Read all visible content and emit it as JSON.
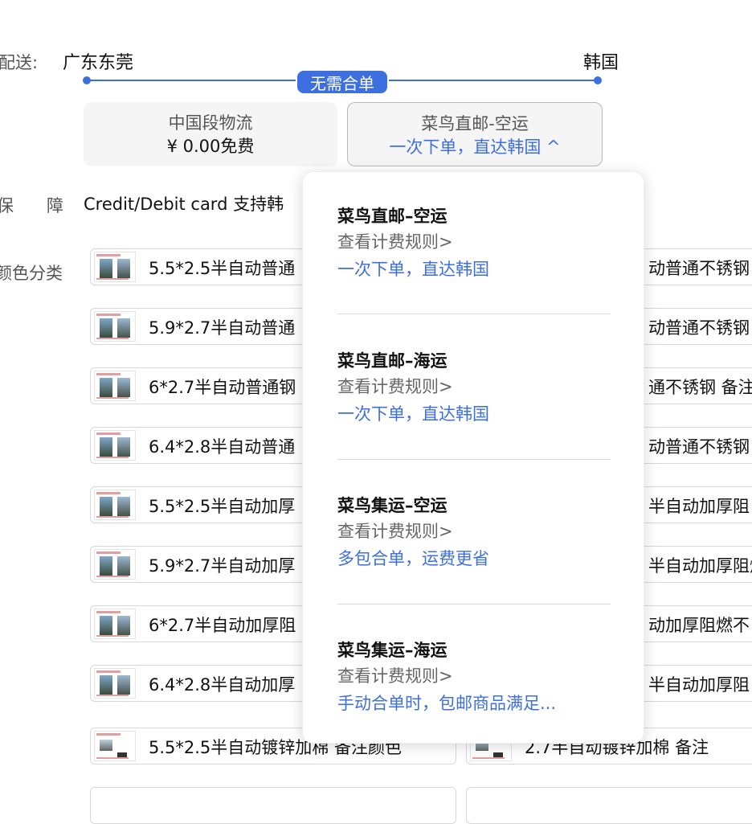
{
  "shipping": {
    "label_partial": "配送:",
    "origin": "广东东莞",
    "destination": "韩国",
    "route_badge": "无需合单",
    "options": [
      {
        "title": "中国段物流",
        "subtitle": "¥ 0.00免费"
      },
      {
        "title": "菜鸟直邮-空运",
        "subtitle": "一次下单，直达韩国 ^"
      }
    ]
  },
  "guarantee": {
    "label_a": "保",
    "label_b": "障",
    "text": "Credit/Debit card 支持韩"
  },
  "variants": {
    "label": "颜色分类",
    "left_items": [
      "5.5*2.5半自动普通",
      "5.9*2.7半自动普通",
      "6*2.7半自动普通钢",
      "6.4*2.8半自动普通",
      "5.5*2.5半自动加厚",
      "5.9*2.7半自动加厚",
      "6*2.7半自动加厚阻",
      "6.4*2.8半自动加厚",
      "5.5*2.5半自动镀锌加棉 备注颜色"
    ],
    "right_items": [
      "动普通不锈钢",
      "动普通不锈钢",
      "通不锈钢 备注",
      "动普通不锈钢",
      "半自动加厚阻",
      "半自动加厚阻燃",
      "动加厚阻燃不",
      "半自动加厚阻",
      "2.7半自动镀锌加棉 备注"
    ]
  },
  "dropdown": {
    "items": [
      {
        "title": "菜鸟直邮–空运",
        "rule": "查看计费规则>",
        "desc": "一次下单，直达韩国"
      },
      {
        "title": "菜鸟直邮–海运",
        "rule": "查看计费规则>",
        "desc": "一次下单，直达韩国"
      },
      {
        "title": "菜鸟集运–空运",
        "rule": "查看计费规则>",
        "desc": "多包合单，运费更省"
      },
      {
        "title": "菜鸟集运–海运",
        "rule": "查看计费规则>",
        "desc": "手动合单时，包邮商品满足..."
      }
    ]
  },
  "colors": {
    "accent": "#3d6fe0",
    "card_bg": "#f5f5f5",
    "border": "#d8d8d8"
  }
}
